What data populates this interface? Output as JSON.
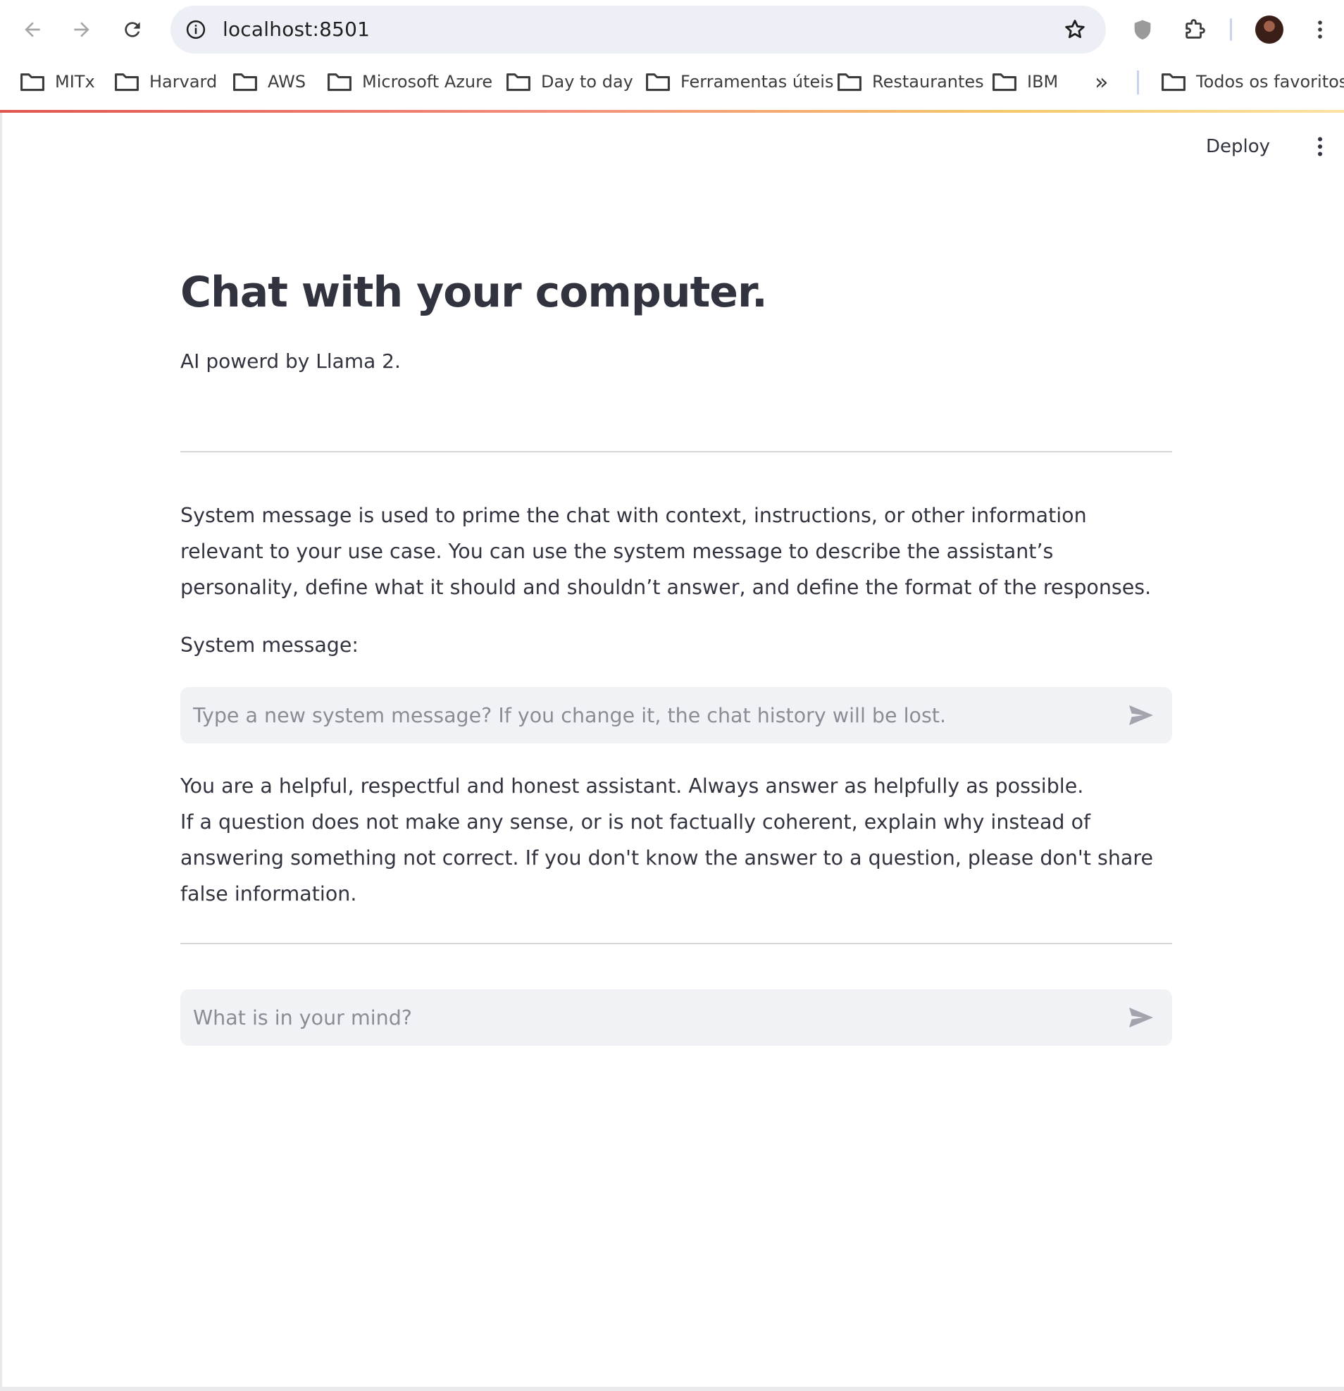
{
  "browser": {
    "url": "localhost:8501",
    "bookmarks": [
      "MITx",
      "Harvard",
      "AWS",
      "Microsoft Azure",
      "Day to day",
      "Ferramentas úteis",
      "Restaurantes",
      "IBM"
    ],
    "overflow_label": "»",
    "all_bookmarks": "Todos os favoritos"
  },
  "app": {
    "deploy_label": "Deploy",
    "title": "Chat with your computer.",
    "subtitle": "AI powerd by Llama 2.",
    "system_description": "System message is used to prime the chat with context, instructions, or other information relevant to your use case. You can use the system message to describe the assistant’s personality, define what it should and shouldn’t answer, and define the format of the responses.",
    "system_label": "System message:",
    "system_input": {
      "value": "",
      "placeholder": "Type a new system message? If you change it, the chat history will be lost."
    },
    "current_system_message": {
      "line1": "You are a helpful, respectful and honest assistant. Always answer as helpfully as possible.",
      "line2": "If a question does not make any sense, or is not factually coherent, explain why instead of answering something not correct. If you don't know the answer to a question, please don't share false information."
    },
    "chat_input": {
      "value": "",
      "placeholder": "What is in your mind?"
    }
  },
  "icons": {
    "back": "arrow-left-icon",
    "forward": "arrow-right-icon",
    "reload": "reload-icon",
    "site_info": "info-icon",
    "star": "star-icon",
    "shield": "shield-icon",
    "extensions": "puzzle-icon",
    "menu": "kebab-menu-icon",
    "folder": "folder-icon",
    "send": "send-icon"
  },
  "colors": {
    "text": "#31333f",
    "input_bg": "#f0f2f6",
    "placeholder": "#8a8c96",
    "address_bg": "#edeff6"
  }
}
